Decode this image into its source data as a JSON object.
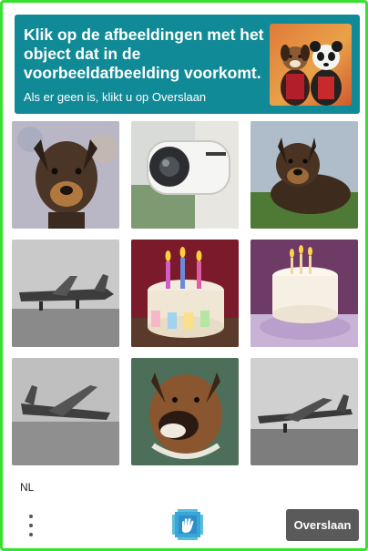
{
  "challenge": {
    "prompt": "Klik op de afbeeldingen met het object dat in de voorbeeldafbeelding voorkomt.",
    "subprompt": "Als er geen is, klikt u op Overslaan",
    "example_image": "two-dogs-costume"
  },
  "tiles": [
    {
      "subject": "dog"
    },
    {
      "subject": "security-camera"
    },
    {
      "subject": "dog"
    },
    {
      "subject": "airplane"
    },
    {
      "subject": "birthday-cake"
    },
    {
      "subject": "birthday-cake"
    },
    {
      "subject": "airplane"
    },
    {
      "subject": "dog"
    },
    {
      "subject": "airplane"
    }
  ],
  "footer": {
    "language": "NL",
    "menu_icon": "three-dots-vertical",
    "logo_icon": "hcaptcha-hand-logo",
    "skip_label": "Overslaan"
  },
  "colors": {
    "frame": "#38e02f",
    "header": "#118a97",
    "skip_button": "#5a5a5a"
  }
}
